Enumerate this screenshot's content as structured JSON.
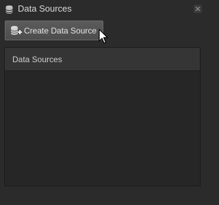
{
  "window": {
    "title": "Data Sources",
    "title_icon": "database-icon",
    "close_icon": "close-icon"
  },
  "toolbar": {
    "create_label": "Create Data Source",
    "create_icon": "add-database-icon"
  },
  "panel": {
    "header": "Data Sources",
    "items": []
  },
  "colors": {
    "background": "#2b2b2b",
    "button": "#555555",
    "panel_header": "#353535",
    "panel_body": "#262626",
    "text": "#d9d9d9"
  }
}
